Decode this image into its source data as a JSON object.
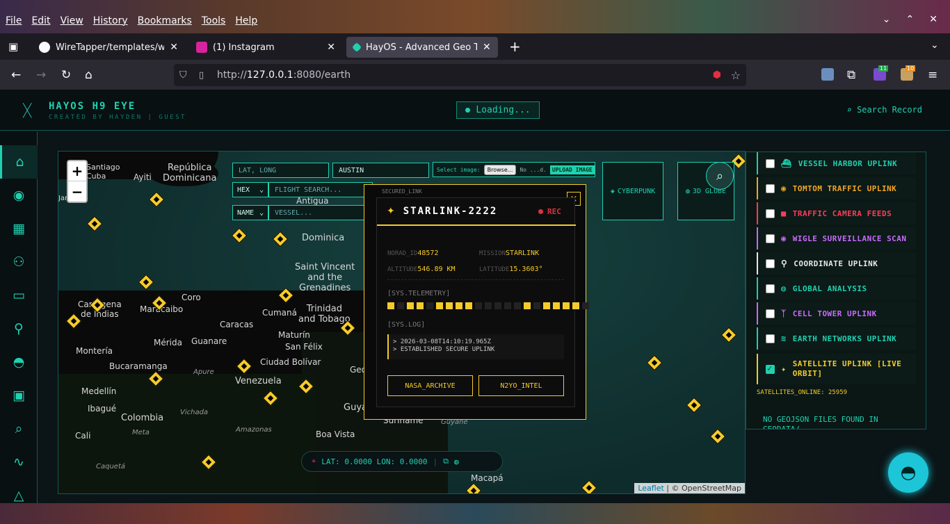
{
  "browser": {
    "menu": [
      "File",
      "Edit",
      "View",
      "History",
      "Bookmarks",
      "Tools",
      "Help"
    ],
    "tabs": [
      {
        "title": "WireTapper/templates/wifi",
        "favicon_color": "#fbfbfe"
      },
      {
        "title": "(1) Instagram",
        "favicon_color": "#d6249f"
      },
      {
        "title": "HayOS - Advanced Geo Tra",
        "favicon_color": "#1fd1b0"
      }
    ],
    "url_prefix": "http://",
    "url_host": "127.0.0.1",
    "url_path": ":8080/earth",
    "ext_badges": [
      "11",
      "10"
    ]
  },
  "app": {
    "brand": "HAYOS H9 EYE",
    "subbrand": "CREATED BY HAYDEN | GUEST",
    "loading": "Loading...",
    "search_record": "Search Record"
  },
  "controls": {
    "latlong_placeholder": "LAT, LONG",
    "city_value": "AUSTIN",
    "select_image_label": "Select image:",
    "browse_label": "Browse...",
    "no_file_label": "No ...d.",
    "upload_label": "UPLOAD IMAGE",
    "hex_select": "HEX",
    "flight_placeholder": "FLIGHT SEARCH...",
    "name_select": "NAME",
    "vessel_placeholder": "VESSEL...",
    "cyberpunk_label": "CYBERPUNK",
    "globe_label": "3D GLOBE"
  },
  "map": {
    "labels": {
      "santiago": "Santiago\nCuba",
      "republica": "República\nDominicana",
      "ayiti": "Ayiti",
      "jamaica": "Jamaica",
      "antigua": "Antigua",
      "dominica": "Dominica",
      "saint_vincent": "Saint Vincent\nand the\nGrenadines",
      "trinidad": "Trinidad\nand Tobago",
      "cartagena": "Cartagena\nde Indias",
      "maracaibo": "Maracaibo",
      "coro": "Coro",
      "caracas": "Caracas",
      "cumana": "Cumaná",
      "maturin": "Maturín",
      "san_felix": "San Félix",
      "merida": "Mérida",
      "guanare": "Guanare",
      "monteria": "Montería",
      "bucaramanga": "Bucaramanga",
      "ciudad_bolivar": "Ciudad Bolívar",
      "apure": "Apure",
      "venezuela": "Venezuela",
      "medellin": "Medellín",
      "ibague": "Ibagué",
      "colombia": "Colombia",
      "vichada": "Vichada",
      "amazonas": "Amazonas",
      "meta": "Meta",
      "cali": "Cali",
      "caqueta": "Caquetá",
      "boa_vista": "Boa Vista",
      "macapa": "Macapá",
      "suriname": "Suriname",
      "guyane": "Guyane",
      "guy": "Guya",
      "geo": "Geo"
    },
    "attribution_link": "Leaflet",
    "attribution_text": "| © OpenStreetMap"
  },
  "popup": {
    "secured_link": "SECURED_LINK",
    "close": "×",
    "name": "STARLINK-2222",
    "rec": "REC",
    "fields": [
      {
        "label": "NORAD_ID",
        "value": "48572"
      },
      {
        "label": "MISSION",
        "value": "STARLINK"
      },
      {
        "label": "ALTITUDE",
        "value": "546.89 KM"
      },
      {
        "label": "LATITUDE",
        "value": "15.3603°"
      }
    ],
    "telemetry_label": "[SYS.TELEMETRY]",
    "telemetry": [
      1,
      0,
      1,
      1,
      0,
      1,
      1,
      1,
      1,
      0,
      0,
      0,
      0,
      0,
      1,
      0,
      1,
      1,
      1,
      1,
      0
    ],
    "log_label": "[SYS.LOG]",
    "log_lines": [
      "> 2026-03-08T14:10:19.965Z",
      "> ESTABLISHED SECURE UPLINK"
    ],
    "btn_nasa": "NASA_ARCHIVE",
    "btn_n2yo": "N2YO_INTEL"
  },
  "coords": {
    "text": "LAT: 0.0000 LON: 0.0000"
  },
  "layers": [
    {
      "label": "VESSEL HARBOR UPLINK",
      "color": "#1fd1b0",
      "icon": "ship-icon",
      "glyph": "⛴",
      "checked": false
    },
    {
      "label": "TOMTOM TRAFFIC UPLINK",
      "color": "#f5a623",
      "icon": "traffic-light-icon",
      "glyph": "◉",
      "checked": false
    },
    {
      "label": "TRAFFIC CAMERA FEEDS",
      "color": "#ff3b5c",
      "icon": "camera-icon",
      "glyph": "■",
      "checked": false
    },
    {
      "label": "WIGLE SURVEILLANCE SCAN",
      "color": "#c86bfa",
      "icon": "eye-icon",
      "glyph": "◉",
      "checked": false
    },
    {
      "label": "COORDINATE UPLINK",
      "color": "#e8e8e8",
      "icon": "pin-icon",
      "glyph": "⚲",
      "checked": false
    },
    {
      "label": "GLOBAL ANALYSIS",
      "color": "#1fd1b0",
      "icon": "globe-icon",
      "glyph": "◍",
      "checked": false
    },
    {
      "label": "CELL TOWER UPLINK",
      "color": "#c86bfa",
      "icon": "tower-icon",
      "glyph": "ᛉ",
      "checked": false
    },
    {
      "label": "EARTH NETWORKS UPLINK",
      "color": "#1fd1b0",
      "icon": "wifi-icon",
      "glyph": "≋",
      "checked": false
    },
    {
      "label": "SATELLITE UPLINK [LIVE ORBIT]",
      "color": "#f5cb2a",
      "icon": "satellite-icon",
      "glyph": "✦",
      "checked": true
    }
  ],
  "satellites_online": "SATELLITES_ONLINE: 25959",
  "no_geojson": "NO GEOJSON FILES FOUND IN GEODATA/"
}
